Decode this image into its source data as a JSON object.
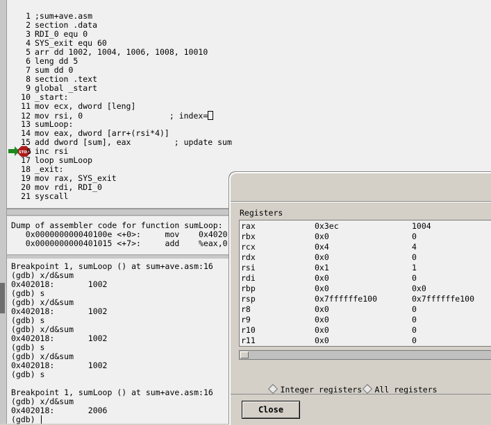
{
  "source": {
    "lines": [
      {
        "n": "1",
        "text": ";sum+ave.asm"
      },
      {
        "n": "2",
        "text": "section .data"
      },
      {
        "n": "3",
        "text": "RDI_0 equ 0"
      },
      {
        "n": "4",
        "text": "SYS_exit equ 60"
      },
      {
        "n": "5",
        "text": "arr dd 1002, 1004, 1006, 1008, 10010"
      },
      {
        "n": "6",
        "text": "leng dd 5"
      },
      {
        "n": "7",
        "text": "sum dd 0"
      },
      {
        "n": "8",
        "text": "section .text"
      },
      {
        "n": "9",
        "text": "global _start"
      },
      {
        "n": "10",
        "text": "_start:"
      },
      {
        "n": "11",
        "text": "mov ecx, dword [leng]"
      },
      {
        "n": "12",
        "text": "mov rsi, 0                  ; index="
      },
      {
        "n": "13",
        "text": "sumLoop:"
      },
      {
        "n": "14",
        "text": "mov eax, dword [arr+(rsi*4)]"
      },
      {
        "n": "15",
        "text": "add dword [sum], eax         ; update sum"
      },
      {
        "n": "16",
        "text": "inc rsi"
      },
      {
        "n": "17",
        "text": "loop sumLoop"
      },
      {
        "n": "18",
        "text": "_exit:"
      },
      {
        "n": "19",
        "text": "mov rax, SYS_exit"
      },
      {
        "n": "20",
        "text": "mov rdi, RDI_0"
      },
      {
        "n": "21",
        "text": "syscall"
      }
    ],
    "breakpoint_label": "STOP",
    "breakpoint_line_digit": "6"
  },
  "asm": {
    "lines": [
      "Dump of assembler code for function sumLoop:",
      "   0x000000000040100e <+0>:     mov    0x4020",
      "   0x0000000000401015 <+7>:     add    %eax,0"
    ]
  },
  "console": {
    "lines": [
      "Breakpoint 1, sumLoop () at sum+ave.asm:16",
      "(gdb) x/d&sum",
      "0x402018:       1002",
      "(gdb) s",
      "(gdb) x/d&sum",
      "0x402018:       1002",
      "(gdb) s",
      "(gdb) x/d&sum",
      "0x402018:       1002",
      "(gdb) s",
      "(gdb) x/d&sum",
      "0x402018:       1002",
      "(gdb) s",
      "",
      "Breakpoint 1, sumLoop () at sum+ave.asm:16",
      "(gdb) x/d&sum",
      "0x402018:       2006",
      "(gdb) "
    ]
  },
  "registers": {
    "title": "Registers",
    "rows": [
      {
        "name": "rax",
        "hex": "0x3ec",
        "val": "1004"
      },
      {
        "name": "rbx",
        "hex": "0x0",
        "val": "0"
      },
      {
        "name": "rcx",
        "hex": "0x4",
        "val": "4"
      },
      {
        "name": "rdx",
        "hex": "0x0",
        "val": "0"
      },
      {
        "name": "rsi",
        "hex": "0x1",
        "val": "1"
      },
      {
        "name": "rdi",
        "hex": "0x0",
        "val": "0"
      },
      {
        "name": "rbp",
        "hex": "0x0",
        "val": "0x0"
      },
      {
        "name": "rsp",
        "hex": "0x7ffffffe100",
        "val": "0x7ffffffe100"
      },
      {
        "name": "r8",
        "hex": "0x0",
        "val": "0"
      },
      {
        "name": "r9",
        "hex": "0x0",
        "val": "0"
      },
      {
        "name": "r10",
        "hex": "0x0",
        "val": "0"
      },
      {
        "name": "r11",
        "hex": "0x0",
        "val": "0"
      }
    ],
    "radio_integer": "Integer registers",
    "radio_all": "All registers",
    "close_label": "Close"
  },
  "colors": {
    "breakpoint_red": "#b01c1c",
    "arrow_green": "#1e8a1e"
  }
}
